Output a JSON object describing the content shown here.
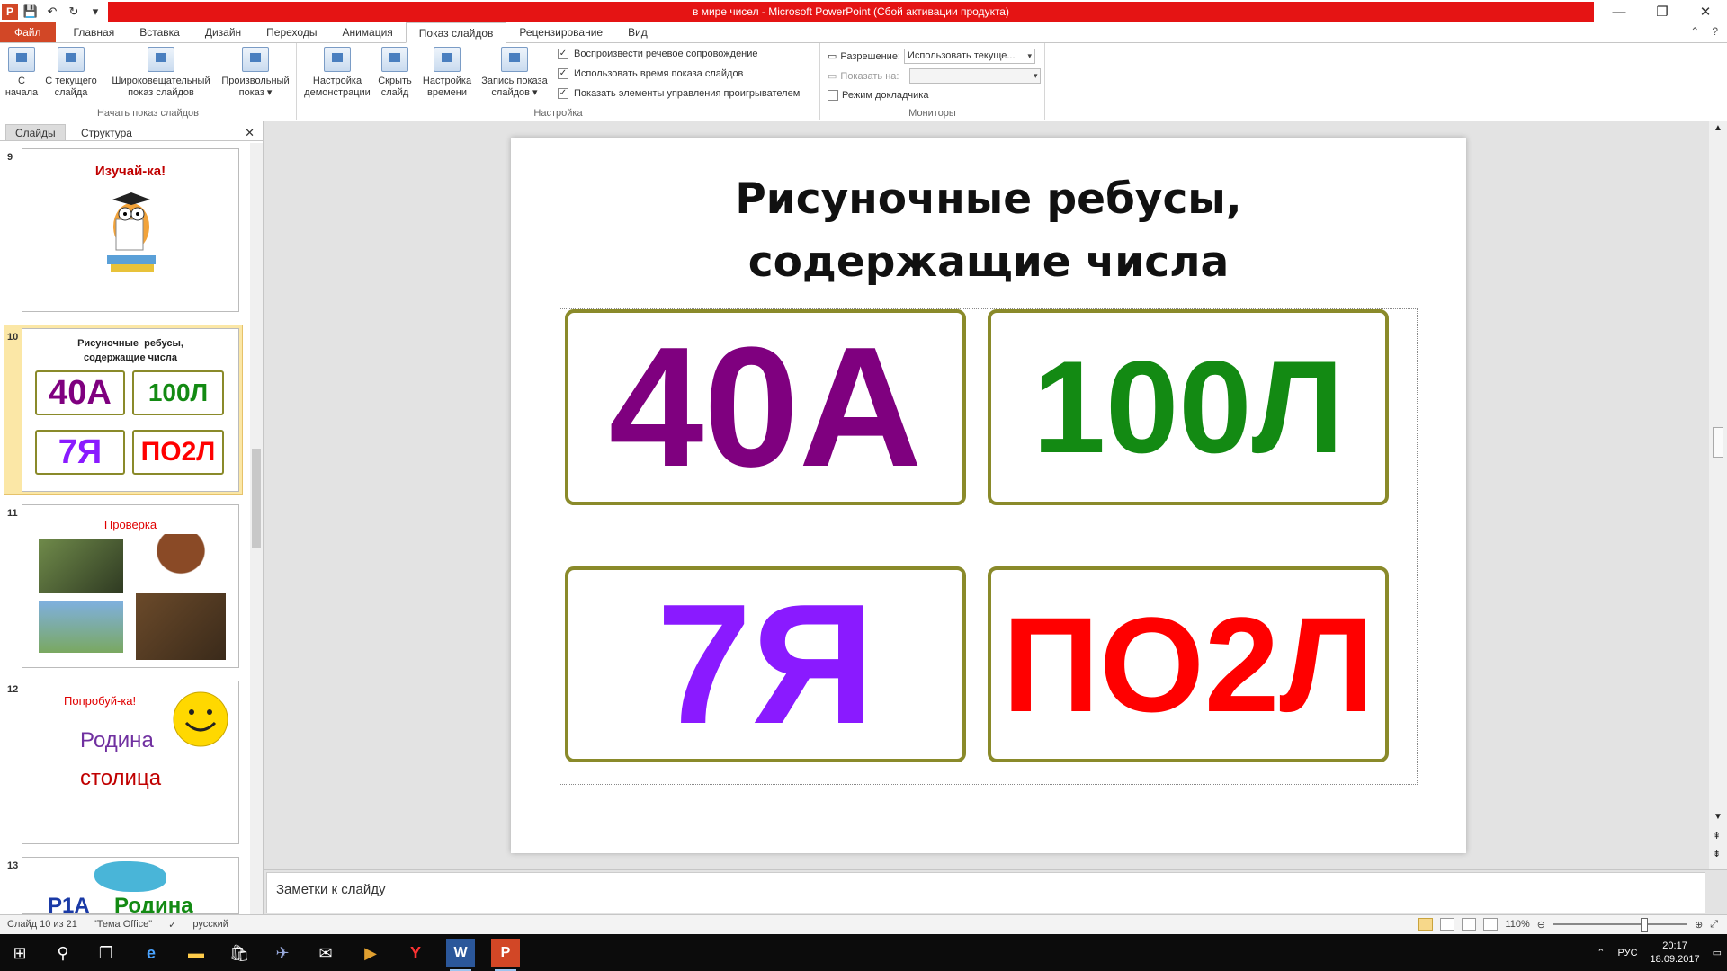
{
  "window": {
    "title": "в мире чисел  -  Microsoft PowerPoint (Сбой активации продукта)",
    "app_icon": "P",
    "qat": [
      "save-icon",
      "undo-icon",
      "redo-icon",
      "customize-icon"
    ]
  },
  "tabs": [
    {
      "label": "Файл"
    },
    {
      "label": "Главная"
    },
    {
      "label": "Вставка"
    },
    {
      "label": "Дизайн"
    },
    {
      "label": "Переходы"
    },
    {
      "label": "Анимация"
    },
    {
      "label": "Показ слайдов"
    },
    {
      "label": "Рецензирование"
    },
    {
      "label": "Вид"
    }
  ],
  "ribbon": {
    "start_group": {
      "label": "Начать показ слайдов",
      "buttons": [
        {
          "label": "С\nначала"
        },
        {
          "label": "С текущего\nслайда"
        },
        {
          "label": "Широковещательный\nпоказ слайдов"
        },
        {
          "label": "Произвольный\nпоказ ▾"
        }
      ]
    },
    "setup_group": {
      "label": "Настройка",
      "buttons": [
        {
          "label": "Настройка\nдемонстрации"
        },
        {
          "label": "Скрыть\nслайд"
        },
        {
          "label": "Настройка\nвремени"
        },
        {
          "label": "Запись показа\nслайдов ▾"
        }
      ],
      "checks": [
        {
          "label": "Воспроизвести речевое сопровождение",
          "checked": true
        },
        {
          "label": "Использовать время показа слайдов",
          "checked": true
        },
        {
          "label": "Показать элементы управления проигрывателем",
          "checked": true
        }
      ]
    },
    "monitors_group": {
      "label": "Мониторы",
      "resolution_label": "Разрешение:",
      "resolution_value": "Использовать текуще...",
      "showon_label": "Показать на:",
      "showon_value": "",
      "presenter_label": "Режим докладчика"
    }
  },
  "left_pane": {
    "tabs": [
      "Слайды",
      "Структура"
    ],
    "slides": [
      {
        "num": "9",
        "title": "Изучай-ка!"
      },
      {
        "num": "10",
        "title": "Рисуночные  ребусы,\nсодержащие числа",
        "items": [
          "40А",
          "100Л",
          "7Я",
          "ПО2Л"
        ]
      },
      {
        "num": "11",
        "title": "Проверка"
      },
      {
        "num": "12",
        "title": "Попробуй-ка!",
        "words": [
          "Родина",
          "столица"
        ]
      },
      {
        "num": "13",
        "words": [
          "Р1А",
          "Родина"
        ]
      }
    ]
  },
  "slide": {
    "title": "Рисуночные ребусы,\nсодержащие числа",
    "rebuses": [
      {
        "text": "40А",
        "color": "#7f007f"
      },
      {
        "text": "100Л",
        "color": "#138a13"
      },
      {
        "text": "7Я",
        "color": "#8a1aff"
      },
      {
        "text": "ПО2Л",
        "color": "#ff0000"
      }
    ]
  },
  "notes": {
    "placeholder": "Заметки к слайду"
  },
  "status": {
    "slide": "Слайд 10 из 21",
    "theme": "\"Тема Office\"",
    "lang": "русский",
    "zoom": "110%"
  },
  "taskbar": {
    "lang": "РУС",
    "time": "20:17",
    "date": "18.09.2017"
  }
}
